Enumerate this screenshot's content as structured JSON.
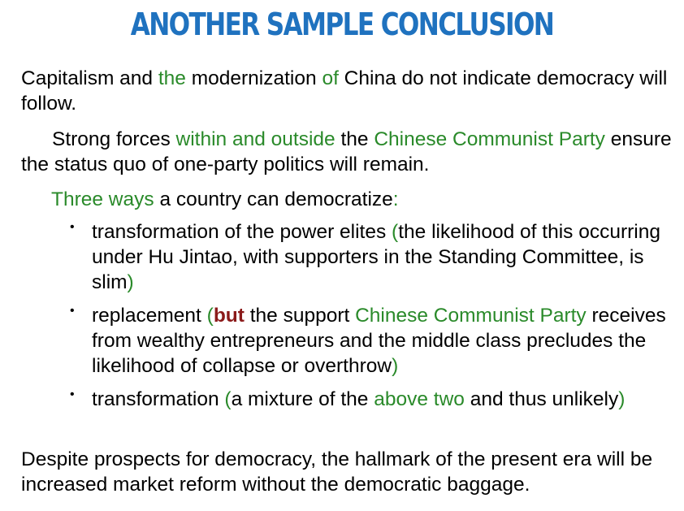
{
  "title": "ANOTHER SAMPLE CONCLUSION",
  "p1": {
    "s1": "Capitalism and ",
    "s2": "the",
    "s3": " modernization ",
    "s4": "of",
    "s5": " China do not indicate democracy will follow."
  },
  "p2": {
    "s1": "Strong forces ",
    "s2": "within and outside",
    "s3": " the ",
    "s4": "Chinese Communist Party",
    "s5": " ensure the status quo of one-party politics will remain."
  },
  "p3": {
    "s1": "Three ways",
    "s2": " a country can democratize",
    "s3": ":"
  },
  "bullets": [
    {
      "dot": "•",
      "s1": "transformation of the power elites ",
      "s2": "(",
      "s3": "the likelihood of this occurring under Hu Jintao, with supporters in the Standing Committee, is slim",
      "s4": ")"
    },
    {
      "dot": "•",
      "s1": "replacement ",
      "s2": "(",
      "s3": "but",
      "s4": " the support ",
      "s5": "Chinese Communist Party",
      "s6": " receives from wealthy entrepreneurs and the middle class precludes the likelihood of collapse or overthrow",
      "s7": ")"
    },
    {
      "dot": "•",
      "s1": "transformation ",
      "s2": "(",
      "s3": "a mixture of the ",
      "s4": "above two",
      "s5": " and thus unlikely",
      "s6": ")"
    }
  ],
  "p4": "Despite prospects for democracy, the hallmark of the present era will be increased market reform without the democratic baggage.",
  "colors": {
    "title": "#1f72bf",
    "green": "#2a8a2a",
    "red": "#8b1a1a",
    "text": "#000000"
  }
}
